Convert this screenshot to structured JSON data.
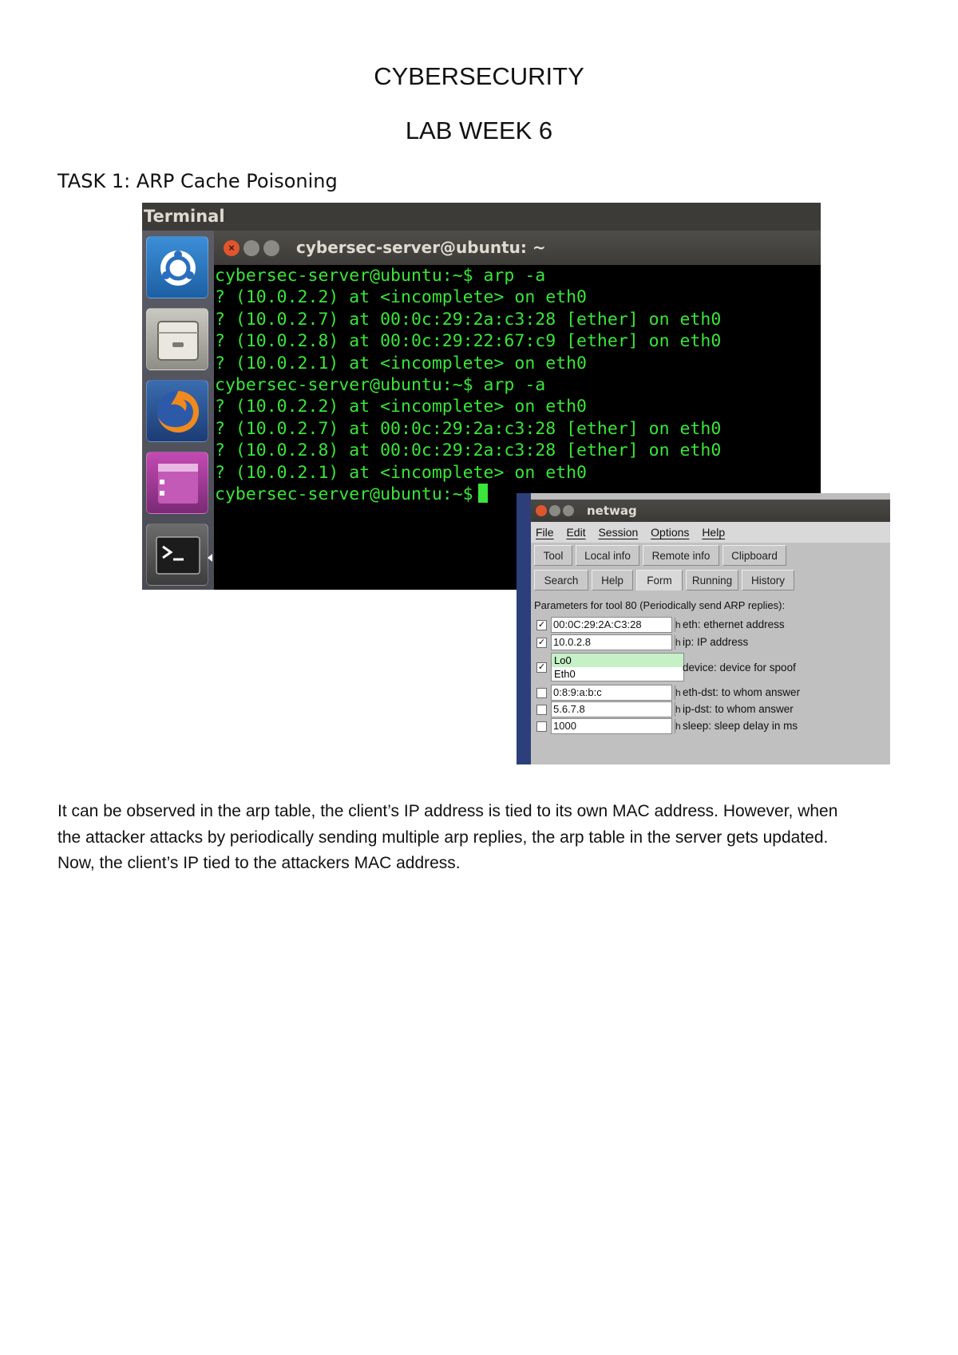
{
  "document": {
    "title": "CYBERSECURITY",
    "subtitle": "LAB WEEK 6",
    "task_heading": "TASK 1: ARP Cache Poisoning",
    "paragraph_lines": [
      "It can be observed in the arp table, the client’s IP address is tied to its own MAC address. However, when",
      "the attacker attacks by periodically sending multiple arp replies, the arp table in the server gets updated.",
      "Now, the client’s IP tied to the attackers MAC address."
    ]
  },
  "terminal": {
    "top_bar_label": "Terminal",
    "window_title": "cybersec-server@ubuntu: ~",
    "close_glyph": "×",
    "lines": [
      "cybersec-server@ubuntu:~$ arp -a",
      "? (10.0.2.2) at <incomplete> on eth0",
      "? (10.0.2.7) at 00:0c:29:2a:c3:28 [ether] on eth0",
      "? (10.0.2.8) at 00:0c:29:22:67:c9 [ether] on eth0",
      "? (10.0.2.1) at <incomplete> on eth0",
      "cybersec-server@ubuntu:~$ arp -a",
      "? (10.0.2.2) at <incomplete> on eth0",
      "? (10.0.2.7) at 00:0c:29:2a:c3:28 [ether] on eth0",
      "? (10.0.2.8) at 00:0c:29:2a:c3:28 [ether] on eth0",
      "? (10.0.2.1) at <incomplete> on eth0",
      "cybersec-server@ubuntu:~$"
    ],
    "launcher_icons": [
      "ubuntu-dash-icon",
      "files-icon",
      "firefox-icon",
      "app-icon",
      "terminal-icon"
    ],
    "text_color": "#39e639"
  },
  "netwag": {
    "window_title": "netwag",
    "menu": [
      "File",
      "Edit",
      "Session",
      "Options",
      "Help"
    ],
    "tabs_row1": [
      "Tool",
      "Local info",
      "Remote info",
      "Clipboard"
    ],
    "tabs_row2": [
      "Search",
      "Help",
      "Form",
      "Running",
      "History"
    ],
    "active_tab": "Form",
    "params_label": "Parameters for tool 80 (Periodically send ARP replies):",
    "params": {
      "eth": {
        "checked": true,
        "value": "00:0C:29:2A:C3:28",
        "h": "h",
        "desc": "eth: ethernet address"
      },
      "ip": {
        "checked": true,
        "value": "10.0.2.8",
        "h": "h",
        "desc": "ip: IP address"
      },
      "device": {
        "checked": true,
        "options": [
          "Lo0",
          "Eth0"
        ],
        "selected": "Lo0",
        "desc": "device: device for spoof"
      },
      "eth_dst": {
        "checked": false,
        "value": "0:8:9:a:b:c",
        "h": "h",
        "desc": "eth-dst: to whom answer"
      },
      "ip_dst": {
        "checked": false,
        "value": "5.6.7.8",
        "h": "h",
        "desc": "ip-dst: to whom answer"
      },
      "sleep": {
        "checked": false,
        "value": "1000",
        "h": "h",
        "desc": "sleep: sleep delay in ms"
      }
    },
    "check_glyph": "✓"
  }
}
